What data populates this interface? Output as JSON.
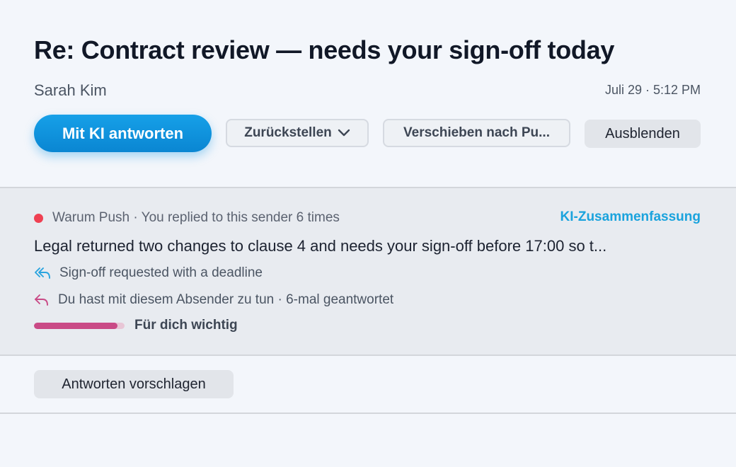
{
  "email": {
    "subject": "Re: Contract review — needs your sign-off today",
    "sender": "Sarah Kim",
    "datetime": "Juli 29 · 5:12 PM"
  },
  "actions": {
    "reply_ai": "Mit KI antworten",
    "snooze": "Zurückstellen",
    "move": "Verschieben nach Pu...",
    "hide": "Ausblenden"
  },
  "insight": {
    "why_label": "Warum Push · You replied to this sender 6 times",
    "ai_summary_link": "KI-Zusammenfassung",
    "summary": "Legal returned two changes to clause 4 and needs your sign-off before 17:00 so t...",
    "reasons": [
      {
        "icon": "reply-all-icon",
        "text": "Sign-off requested with a deadline"
      },
      {
        "icon": "reply-icon",
        "text": "Du hast mit diesem Absender zu tun · 6-mal geantwortet"
      }
    ],
    "importance": {
      "label": "Für dich wichtig",
      "level": 0.92
    }
  },
  "footer": {
    "suggest_replies": "Antworten vorschlagen"
  },
  "colors": {
    "accent": "#0a86d2",
    "link": "#1aa3dd",
    "status_dot": "#ef4052",
    "importance_bar": "#c94a86",
    "reason_icon_1": "#2aa4df",
    "reason_icon_2": "#c94a86"
  }
}
